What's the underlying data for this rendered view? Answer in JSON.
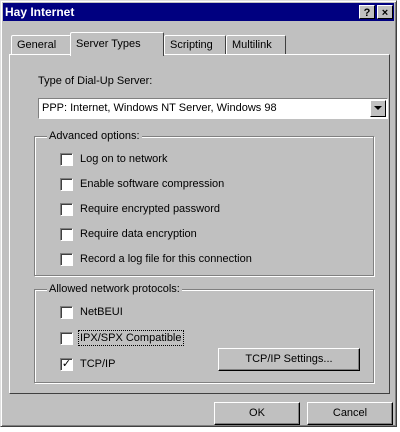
{
  "window": {
    "title": "Hay Internet",
    "help_label": "?",
    "close_label": "×"
  },
  "tabs": [
    {
      "label": "General",
      "active": false
    },
    {
      "label": "Server Types",
      "active": true
    },
    {
      "label": "Scripting",
      "active": false
    },
    {
      "label": "Multilink",
      "active": false
    }
  ],
  "server_type": {
    "label": "Type of Dial-Up Server:",
    "selected": "PPP: Internet, Windows NT Server, Windows 98"
  },
  "advanced": {
    "title": "Advanced options:",
    "options": [
      {
        "label": "Log on to network",
        "checked": false
      },
      {
        "label": "Enable software compression",
        "checked": false
      },
      {
        "label": "Require encrypted password",
        "checked": false
      },
      {
        "label": "Require data encryption",
        "checked": false
      },
      {
        "label": "Record a log file for this connection",
        "checked": false
      }
    ]
  },
  "protocols": {
    "title": "Allowed network protocols:",
    "options": [
      {
        "label": "NetBEUI",
        "checked": false
      },
      {
        "label": "IPX/SPX Compatible",
        "checked": false
      },
      {
        "label": "TCP/IP",
        "checked": true
      }
    ],
    "settings_button": "TCP/IP Settings..."
  },
  "buttons": {
    "ok": "OK",
    "cancel": "Cancel"
  },
  "check_glyph": "✓"
}
